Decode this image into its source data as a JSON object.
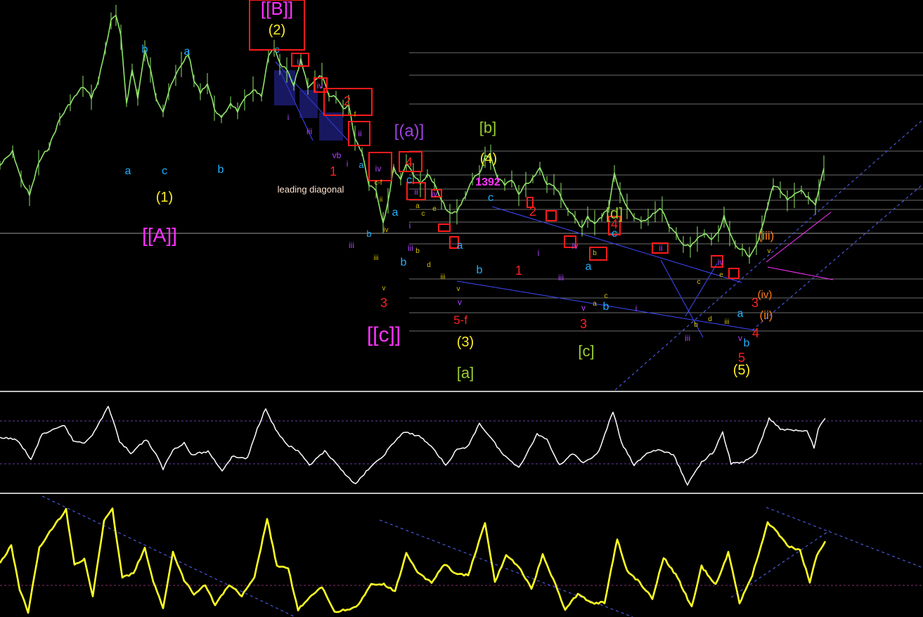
{
  "colors": {
    "background": "#000000",
    "price": "#8fe36a",
    "gridline": "#6b6b6b",
    "pane_separator": "#bfbfbf",
    "osc1": "#ffffff",
    "osc2": "#ffff22",
    "trendline": "#3f49ff",
    "channel_dashed": "#5566ff",
    "marker_box": "#ff1a1a",
    "wave_cyan": "#1fb0ff",
    "wave_yellow": "#ffee22",
    "wave_magenta": "#ff33ff",
    "wave_red": "#ff2020",
    "wave_purple": "#b040ff",
    "wave_olive": "#9acd32",
    "wave_orange": "#ff7a1a",
    "wave_small_yellow": "#d4c000"
  },
  "annotations": {
    "lvl_A": "[[A]]",
    "lvl_B": "[[B]]",
    "lvl_c": "[[c]]",
    "lvl_1": "(1)",
    "lvl_2": "(2)",
    "lvl_3": "(3)",
    "lvl_4": "(4)",
    "lvl_5": "(5)",
    "lvl_a_paren": "[(a)]",
    "lvl_a_sq": "[a]",
    "lvl_b_sq": "[b]",
    "lvl_c_sq": "[c]",
    "lvl_d_sq": "[d]",
    "price_1392": "1392",
    "leading_diagonal": "leading diagonal",
    "five_f": "5-f",
    "iii_paren": "(iii)",
    "ii_paren": "(ii)",
    "iv_paren": "(iv)",
    "small": {
      "a": "a",
      "b": "b",
      "c": "c",
      "d": "d",
      "e": "e",
      "f": "f",
      "i": "i",
      "ii": "ii",
      "iii": "iii",
      "iv": "iv",
      "v": "v",
      "vb": "vb",
      "cf": "c-f",
      "n1": "1",
      "n2": "2",
      "n3": "3",
      "n4": "4",
      "n5": "5"
    }
  },
  "chart_data": [
    {
      "type": "line",
      "pane": "price",
      "series": [
        {
          "values": [
            [
              0,
              0.55
            ],
            [
              18,
              0.5
            ],
            [
              30,
              0.6
            ],
            [
              42,
              0.66
            ],
            [
              55,
              0.54
            ],
            [
              70,
              0.48
            ],
            [
              85,
              0.38
            ],
            [
              100,
              0.32
            ],
            [
              118,
              0.26
            ],
            [
              130,
              0.3
            ],
            [
              140,
              0.24
            ],
            [
              150,
              0.12
            ],
            [
              158,
              0.02
            ],
            [
              165,
              0.0
            ],
            [
              172,
              0.08
            ],
            [
              180,
              0.32
            ],
            [
              188,
              0.2
            ],
            [
              196,
              0.3
            ],
            [
              206,
              0.13
            ],
            [
              214,
              0.2
            ],
            [
              222,
              0.3
            ],
            [
              232,
              0.35
            ],
            [
              240,
              0.28
            ],
            [
              250,
              0.22
            ],
            [
              258,
              0.18
            ],
            [
              268,
              0.14
            ],
            [
              276,
              0.24
            ],
            [
              285,
              0.28
            ],
            [
              295,
              0.25
            ],
            [
              305,
              0.34
            ],
            [
              315,
              0.38
            ],
            [
              328,
              0.32
            ],
            [
              338,
              0.35
            ],
            [
              348,
              0.31
            ],
            [
              360,
              0.27
            ],
            [
              372,
              0.3
            ],
            [
              382,
              0.15
            ],
            [
              390,
              0.12
            ],
            [
              398,
              0.18
            ],
            [
              408,
              0.2
            ],
            [
              418,
              0.26
            ],
            [
              428,
              0.16
            ],
            [
              438,
              0.26
            ],
            [
              448,
              0.24
            ],
            [
              458,
              0.22
            ],
            [
              468,
              0.3
            ],
            [
              478,
              0.3
            ],
            [
              488,
              0.34
            ],
            [
              496,
              0.33
            ],
            [
              505,
              0.45
            ],
            [
              515,
              0.5
            ],
            [
              525,
              0.62
            ],
            [
              535,
              0.64
            ],
            [
              545,
              0.76
            ],
            [
              552,
              0.68
            ],
            [
              560,
              0.56
            ],
            [
              570,
              0.6
            ],
            [
              578,
              0.54
            ],
            [
              588,
              0.58
            ],
            [
              598,
              0.62
            ],
            [
              608,
              0.58
            ],
            [
              618,
              0.62
            ],
            [
              628,
              0.68
            ],
            [
              640,
              0.73
            ],
            [
              650,
              0.72
            ],
            [
              662,
              0.66
            ],
            [
              672,
              0.6
            ],
            [
              682,
              0.58
            ],
            [
              690,
              0.52
            ],
            [
              698,
              0.52
            ],
            [
              708,
              0.6
            ],
            [
              718,
              0.62
            ],
            [
              728,
              0.6
            ],
            [
              738,
              0.66
            ],
            [
              748,
              0.62
            ],
            [
              758,
              0.6
            ],
            [
              768,
              0.56
            ],
            [
              778,
              0.62
            ],
            [
              788,
              0.62
            ],
            [
              798,
              0.66
            ],
            [
              808,
              0.72
            ],
            [
              818,
              0.74
            ],
            [
              828,
              0.78
            ],
            [
              836,
              0.74
            ],
            [
              846,
              0.76
            ],
            [
              856,
              0.74
            ],
            [
              866,
              0.7
            ],
            [
              874,
              0.58
            ],
            [
              882,
              0.65
            ],
            [
              892,
              0.7
            ],
            [
              902,
              0.74
            ],
            [
              912,
              0.76
            ],
            [
              922,
              0.74
            ],
            [
              932,
              0.72
            ],
            [
              942,
              0.71
            ],
            [
              952,
              0.78
            ],
            [
              962,
              0.8
            ],
            [
              972,
              0.84
            ],
            [
              982,
              0.85
            ],
            [
              992,
              0.82
            ],
            [
              1002,
              0.8
            ],
            [
              1012,
              0.82
            ],
            [
              1022,
              0.8
            ],
            [
              1030,
              0.74
            ],
            [
              1038,
              0.8
            ],
            [
              1046,
              0.84
            ],
            [
              1056,
              0.86
            ],
            [
              1066,
              0.88
            ],
            [
              1076,
              0.84
            ],
            [
              1084,
              0.78
            ],
            [
              1092,
              0.7
            ],
            [
              1100,
              0.62
            ],
            [
              1110,
              0.64
            ],
            [
              1120,
              0.68
            ],
            [
              1130,
              0.66
            ],
            [
              1140,
              0.64
            ],
            [
              1150,
              0.67
            ],
            [
              1160,
              0.7
            ],
            [
              1165,
              0.64
            ],
            [
              1172,
              0.56
            ]
          ]
        }
      ]
    },
    {
      "type": "line",
      "pane": "oscillator-1",
      "series": [
        {
          "values": [
            [
              0,
              0.45
            ],
            [
              18,
              0.45
            ],
            [
              30,
              0.52
            ],
            [
              44,
              0.7
            ],
            [
              60,
              0.4
            ],
            [
              78,
              0.35
            ],
            [
              92,
              0.3
            ],
            [
              104,
              0.48
            ],
            [
              120,
              0.5
            ],
            [
              134,
              0.38
            ],
            [
              154,
              0.08
            ],
            [
              170,
              0.48
            ],
            [
              186,
              0.62
            ],
            [
              208,
              0.46
            ],
            [
              222,
              0.64
            ],
            [
              232,
              0.8
            ],
            [
              246,
              0.58
            ],
            [
              262,
              0.5
            ],
            [
              272,
              0.64
            ],
            [
              296,
              0.6
            ],
            [
              316,
              0.82
            ],
            [
              330,
              0.66
            ],
            [
              352,
              0.68
            ],
            [
              366,
              0.34
            ],
            [
              378,
              0.1
            ],
            [
              392,
              0.35
            ],
            [
              408,
              0.52
            ],
            [
              424,
              0.6
            ],
            [
              440,
              0.76
            ],
            [
              462,
              0.6
            ],
            [
              482,
              0.78
            ],
            [
              506,
              0.98
            ],
            [
              524,
              0.8
            ],
            [
              542,
              0.68
            ],
            [
              560,
              0.5
            ],
            [
              574,
              0.38
            ],
            [
              596,
              0.42
            ],
            [
              616,
              0.56
            ],
            [
              634,
              0.76
            ],
            [
              650,
              0.58
            ],
            [
              664,
              0.56
            ],
            [
              682,
              0.28
            ],
            [
              698,
              0.44
            ],
            [
              716,
              0.64
            ],
            [
              738,
              0.78
            ],
            [
              750,
              0.62
            ],
            [
              764,
              0.4
            ],
            [
              778,
              0.46
            ],
            [
              796,
              0.76
            ],
            [
              814,
              0.62
            ],
            [
              830,
              0.74
            ],
            [
              852,
              0.6
            ],
            [
              872,
              0.14
            ],
            [
              884,
              0.5
            ],
            [
              902,
              0.76
            ],
            [
              920,
              0.62
            ],
            [
              936,
              0.58
            ],
            [
              958,
              0.64
            ],
            [
              978,
              0.98
            ],
            [
              998,
              0.72
            ],
            [
              1016,
              0.6
            ],
            [
              1028,
              0.38
            ],
            [
              1040,
              0.74
            ],
            [
              1058,
              0.72
            ],
            [
              1076,
              0.62
            ],
            [
              1094,
              0.22
            ],
            [
              1110,
              0.34
            ],
            [
              1126,
              0.36
            ],
            [
              1148,
              0.36
            ],
            [
              1158,
              0.55
            ],
            [
              1164,
              0.34
            ],
            [
              1174,
              0.22
            ]
          ]
        }
      ]
    },
    {
      "type": "line",
      "pane": "oscillator-2",
      "series": [
        {
          "values": [
            [
              0,
              0.55
            ],
            [
              16,
              0.4
            ],
            [
              28,
              0.78
            ],
            [
              40,
              0.98
            ],
            [
              56,
              0.42
            ],
            [
              68,
              0.3
            ],
            [
              80,
              0.2
            ],
            [
              94,
              0.08
            ],
            [
              106,
              0.56
            ],
            [
              120,
              0.52
            ],
            [
              132,
              0.84
            ],
            [
              148,
              0.18
            ],
            [
              160,
              0.08
            ],
            [
              174,
              0.68
            ],
            [
              190,
              0.64
            ],
            [
              206,
              0.42
            ],
            [
              218,
              0.72
            ],
            [
              232,
              0.94
            ],
            [
              246,
              0.46
            ],
            [
              262,
              0.7
            ],
            [
              276,
              0.82
            ],
            [
              292,
              0.74
            ],
            [
              306,
              0.92
            ],
            [
              326,
              0.74
            ],
            [
              344,
              0.84
            ],
            [
              362,
              0.68
            ],
            [
              380,
              0.16
            ],
            [
              394,
              0.58
            ],
            [
              410,
              0.6
            ],
            [
              424,
              0.96
            ],
            [
              440,
              0.86
            ],
            [
              458,
              0.76
            ],
            [
              476,
              0.98
            ],
            [
              494,
              0.96
            ],
            [
              510,
              0.92
            ],
            [
              528,
              0.74
            ],
            [
              546,
              0.74
            ],
            [
              562,
              0.8
            ],
            [
              578,
              0.46
            ],
            [
              594,
              0.64
            ],
            [
              614,
              0.72
            ],
            [
              632,
              0.56
            ],
            [
              648,
              0.64
            ],
            [
              666,
              0.66
            ],
            [
              690,
              0.2
            ],
            [
              704,
              0.72
            ],
            [
              720,
              0.48
            ],
            [
              738,
              0.58
            ],
            [
              756,
              0.78
            ],
            [
              772,
              0.48
            ],
            [
              790,
              0.74
            ],
            [
              804,
              0.96
            ],
            [
              822,
              0.82
            ],
            [
              840,
              0.9
            ],
            [
              860,
              0.9
            ],
            [
              878,
              0.34
            ],
            [
              892,
              0.62
            ],
            [
              910,
              0.72
            ],
            [
              928,
              0.86
            ],
            [
              944,
              0.5
            ],
            [
              964,
              0.68
            ],
            [
              984,
              0.94
            ],
            [
              998,
              0.58
            ],
            [
              1018,
              0.74
            ],
            [
              1036,
              0.46
            ],
            [
              1052,
              0.9
            ],
            [
              1070,
              0.66
            ],
            [
              1092,
              0.2
            ],
            [
              1106,
              0.28
            ],
            [
              1120,
              0.4
            ],
            [
              1138,
              0.44
            ],
            [
              1152,
              0.72
            ],
            [
              1162,
              0.48
            ],
            [
              1174,
              0.36
            ]
          ]
        }
      ]
    }
  ]
}
